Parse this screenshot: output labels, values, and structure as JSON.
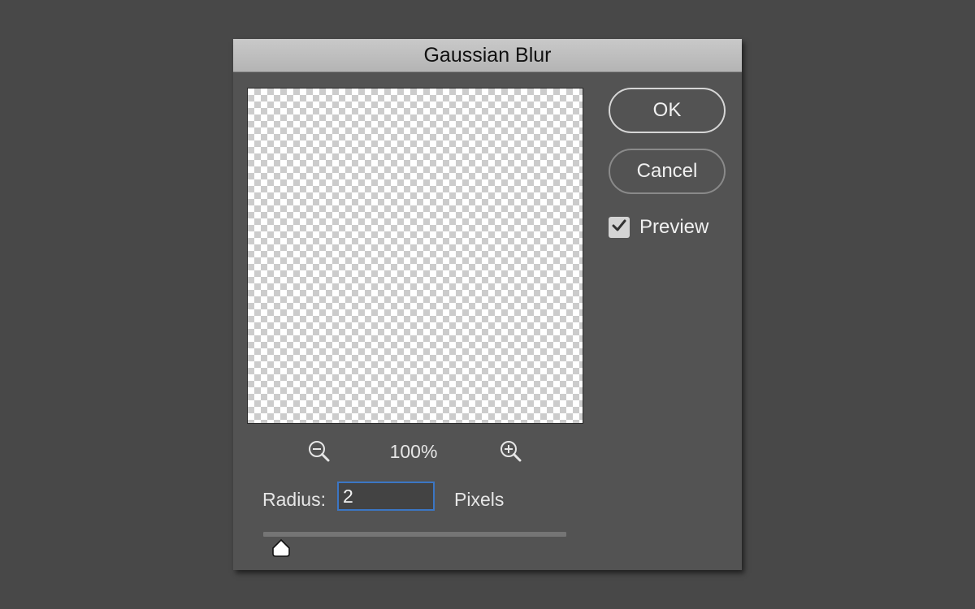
{
  "dialog": {
    "title": "Gaussian Blur"
  },
  "buttons": {
    "ok_label": "OK",
    "cancel_label": "Cancel"
  },
  "preview": {
    "label": "Preview",
    "checked": true
  },
  "zoom": {
    "level": "100%",
    "zoom_out_icon": "zoom-out-icon",
    "zoom_in_icon": "zoom-in-icon"
  },
  "radius": {
    "label": "Radius:",
    "value": "2",
    "units": "Pixels",
    "slider_fraction": 0.06
  },
  "colors": {
    "dialog_bg": "#535353",
    "titlebar": "#c0c0c0",
    "input_focus": "#3b76c4",
    "background": "#484848"
  }
}
